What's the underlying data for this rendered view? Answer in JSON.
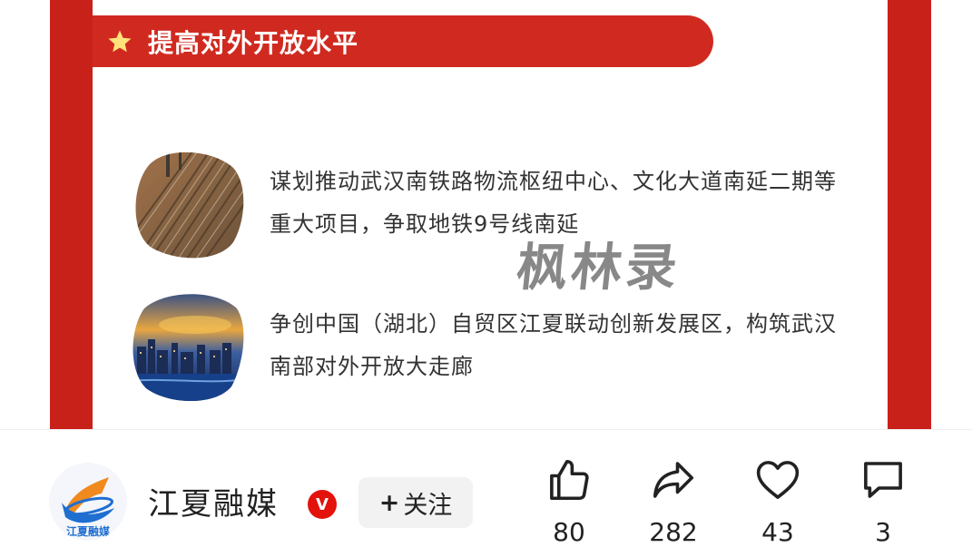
{
  "section": {
    "title": "提高对外开放水平",
    "star_icon": "star-icon"
  },
  "items": [
    {
      "text": "谋划推动武汉南铁路物流枢纽中心、文化大道南延二期等重大项目，争取地铁9号线南延",
      "image": "railway-yard-photo"
    },
    {
      "text": "争创中国（湖北）自贸区江夏联动创新发展区，构筑武汉南部对外开放大走廊",
      "image": "city-skyline-photo"
    }
  ],
  "watermark": "枫林录",
  "account": {
    "name": "江夏融媒",
    "verified_badge": "V",
    "follow_plus": "+",
    "follow_label": "关注",
    "avatar_text": "江夏融媒"
  },
  "actions": {
    "like_count": "80",
    "share_count": "282",
    "favorite_count": "43",
    "comment_count": "3"
  },
  "colors": {
    "frame_red": "#c8211a",
    "banner_red": "#d02a20",
    "star_yellow": "#ffe27a",
    "verified_red": "#e3120b"
  }
}
